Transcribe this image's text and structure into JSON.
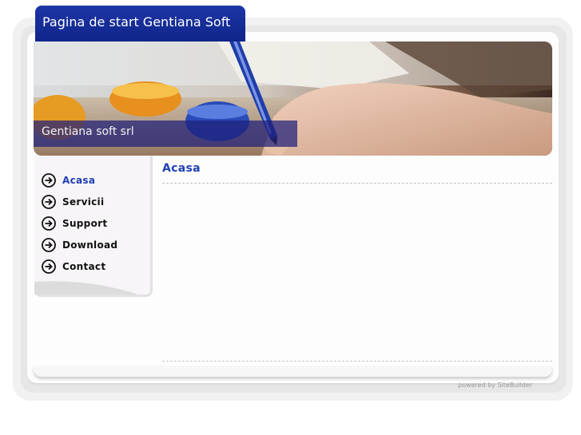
{
  "header": {
    "title": "Pagina de start Gentiana Soft"
  },
  "banner": {
    "company": "Gentiana soft srl",
    "image": "hand-writing-with-pen-photo"
  },
  "sidebar": {
    "items": [
      {
        "label": "Acasa",
        "active": true,
        "icon": "arrow-circle-right-icon"
      },
      {
        "label": "Servicii",
        "active": false,
        "icon": "arrow-circle-right-icon"
      },
      {
        "label": "Support",
        "active": false,
        "icon": "arrow-circle-right-icon"
      },
      {
        "label": "Download",
        "active": false,
        "icon": "arrow-circle-right-icon"
      },
      {
        "label": "Contact",
        "active": false,
        "icon": "arrow-circle-right-icon"
      }
    ]
  },
  "main": {
    "title": "Acasa"
  },
  "footer": {
    "text": "powered by SiteBuilder"
  },
  "colors": {
    "title_bg": "#1d35a6",
    "accent_text": "#1f3fb3",
    "sidebar_bg": "#f7f5f7"
  }
}
